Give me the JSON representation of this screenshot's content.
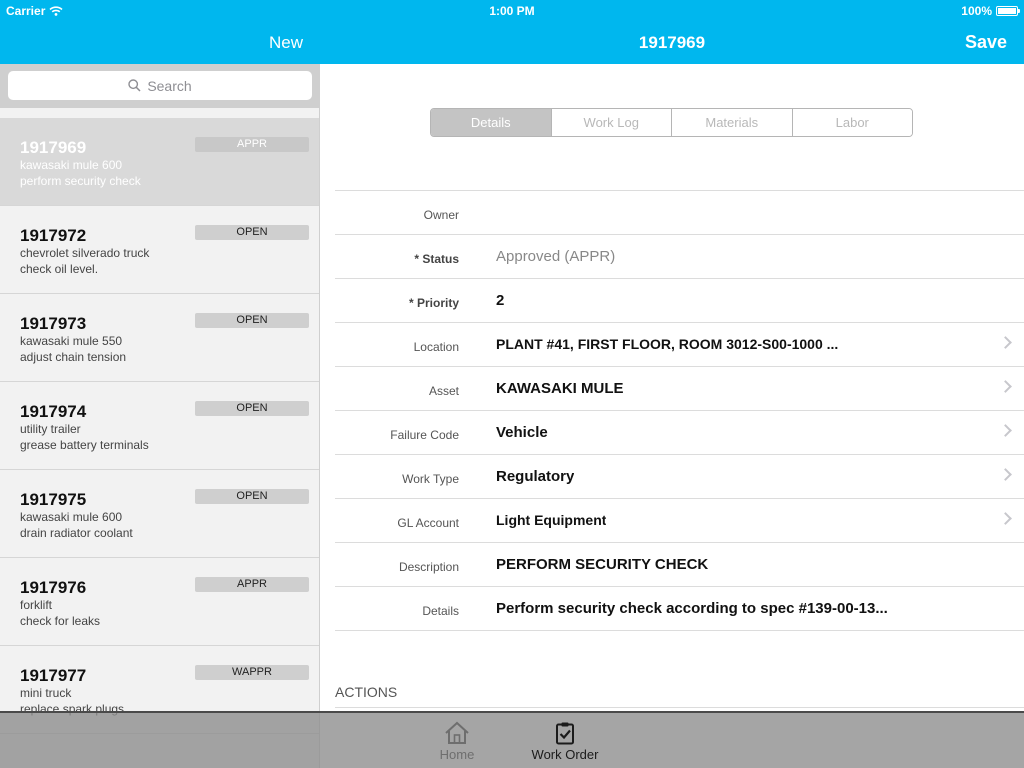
{
  "status_bar": {
    "carrier": "Carrier",
    "time": "1:00 PM",
    "battery": "100%"
  },
  "nav": {
    "new_label": "New",
    "title": "1917969",
    "save_label": "Save"
  },
  "search": {
    "placeholder": "Search"
  },
  "work_orders": [
    {
      "id": "1917969",
      "asset": "kawasaki mule 600",
      "task": "perform security check",
      "status": "APPR"
    },
    {
      "id": "1917972",
      "asset": "chevrolet silverado truck",
      "task": "check oil level.",
      "status": "OPEN"
    },
    {
      "id": "1917973",
      "asset": "kawasaki mule 550",
      "task": "adjust chain tension",
      "status": "OPEN"
    },
    {
      "id": "1917974",
      "asset": "utility trailer",
      "task": "grease battery terminals",
      "status": "OPEN"
    },
    {
      "id": "1917975",
      "asset": "kawasaki mule 600",
      "task": "drain radiator coolant",
      "status": "OPEN"
    },
    {
      "id": "1917976",
      "asset": "forklift",
      "task": "check for leaks",
      "status": "APPR"
    },
    {
      "id": "1917977",
      "asset": "mini truck",
      "task": "replace spark plugs",
      "status": "WAPPR"
    }
  ],
  "tabs": [
    "Details",
    "Work Log",
    "Materials",
    "Labor"
  ],
  "details": {
    "owner": {
      "label": "Owner",
      "value": ""
    },
    "status": {
      "label": "* Status",
      "value": "Approved (APPR)"
    },
    "priority": {
      "label": "* Priority",
      "value": "2"
    },
    "location": {
      "label": "Location",
      "value": "PLANT #41, FIRST FLOOR, ROOM 3012-S00-1000 ..."
    },
    "asset": {
      "label": "Asset",
      "value": "KAWASAKI MULE"
    },
    "failure_code": {
      "label": "Failure Code",
      "value": "Vehicle"
    },
    "work_type": {
      "label": "Work Type",
      "value": "Regulatory"
    },
    "gl_account": {
      "label": "GL Account",
      "value": "Light Equipment"
    },
    "description": {
      "label": "Description",
      "value": "PERFORM SECURITY CHECK"
    },
    "details_text": {
      "label": "Details",
      "value": "Perform security check according to spec #139-00-13..."
    }
  },
  "actions_header": "ACTIONS",
  "tab_bar": {
    "home": "Home",
    "work_order": "Work Order"
  },
  "colors": {
    "accent": "#00b7ee",
    "selected_row": "#d9d9d9"
  }
}
